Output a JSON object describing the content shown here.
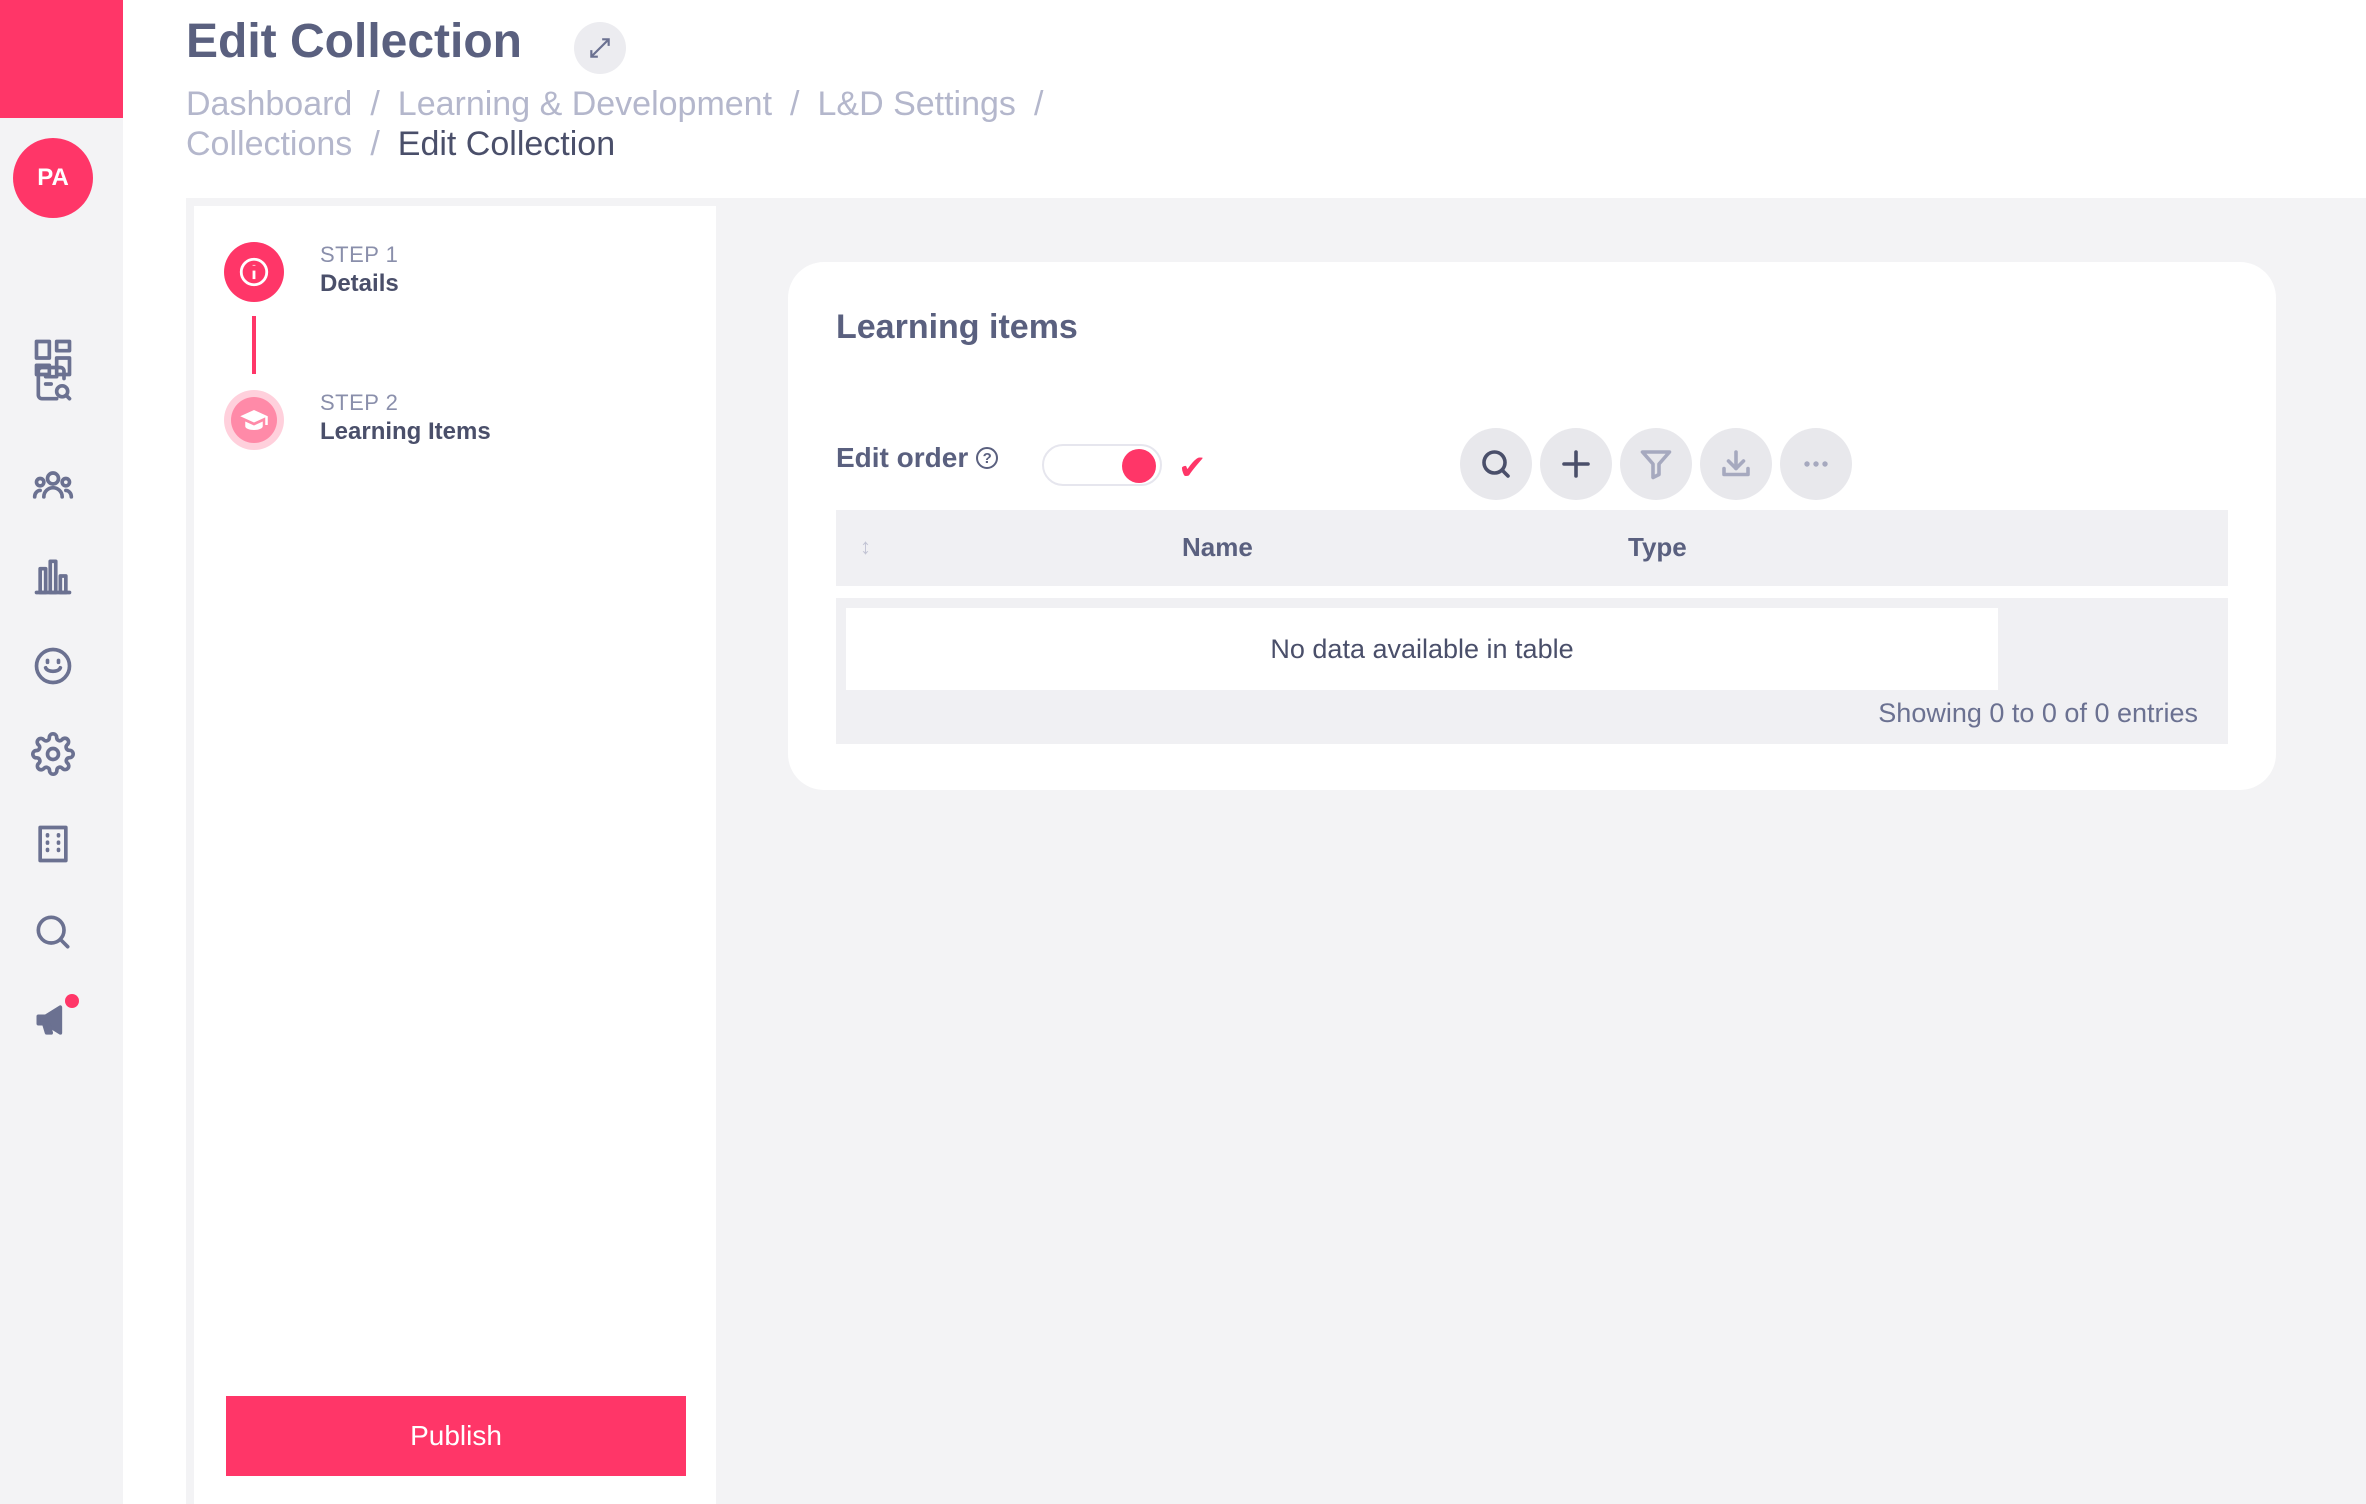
{
  "sidebar": {
    "avatar_initials": "PA",
    "icons": [
      "dashboard-icon",
      "search-document-icon",
      "people-icon",
      "bar-chart-icon",
      "smiley-icon",
      "gear-icon",
      "building-icon",
      "search-icon",
      "megaphone-icon"
    ]
  },
  "header": {
    "title": "Edit Collection",
    "breadcrumb": [
      "Dashboard",
      "Learning & Development",
      "L&D Settings",
      "Collections",
      "Edit Collection"
    ]
  },
  "steps": [
    {
      "number": "STEP 1",
      "label": "Details",
      "icon": "info-icon"
    },
    {
      "number": "STEP 2",
      "label": "Learning Items",
      "icon": "graduation-cap-icon"
    }
  ],
  "publish_label": "Publish",
  "card": {
    "title": "Learning items",
    "edit_order_label": "Edit order",
    "edit_order_enabled": true,
    "table": {
      "columns": [
        "Name",
        "Type"
      ],
      "empty_text": "No data available in table",
      "entries_text": "Showing 0 to 0 of 0 entries"
    }
  },
  "colors": {
    "accent": "#ff3668",
    "text": "#5a607f",
    "muted": "#b4b7cc",
    "background": "#f3f3f5"
  }
}
